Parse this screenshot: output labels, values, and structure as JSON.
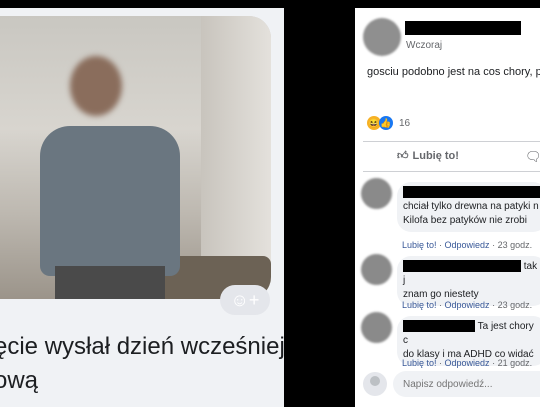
{
  "post": {
    "timestamp": "Wczoraj",
    "text": "gosciu podobno jest na cos chory, p",
    "reaction_count": "16",
    "like_label": "Lubię to!"
  },
  "photo_caption": {
    "line1": "ęcie wysłał dzień wcześniej",
    "line2": "ową"
  },
  "comments": [
    {
      "text_line1": "chciał tylko drewna na patyki n",
      "text_line2": "Kilofa bez patyków nie zrobi",
      "like": "Lubię to!",
      "reply": "Odpowiedz",
      "time": "23 godz."
    },
    {
      "text_line1": "tak j",
      "text_line2": "znam go niestety",
      "like": "Lubię to!",
      "reply": "Odpowiedz",
      "time": "23 godz."
    },
    {
      "text_line1": "Ta jest chory c",
      "text_line2": "do klasy i ma ADHD co widać",
      "like": "Lubię to!",
      "reply": "Odpowiedz",
      "time": "21 godz."
    }
  ],
  "reply_placeholder": "Napisz odpowiedź...",
  "icons": {
    "like": "thumbs-up-icon",
    "comment": "comment-icon",
    "haha": "haha-emoji-icon",
    "add_reaction": "add-reaction-icon"
  }
}
